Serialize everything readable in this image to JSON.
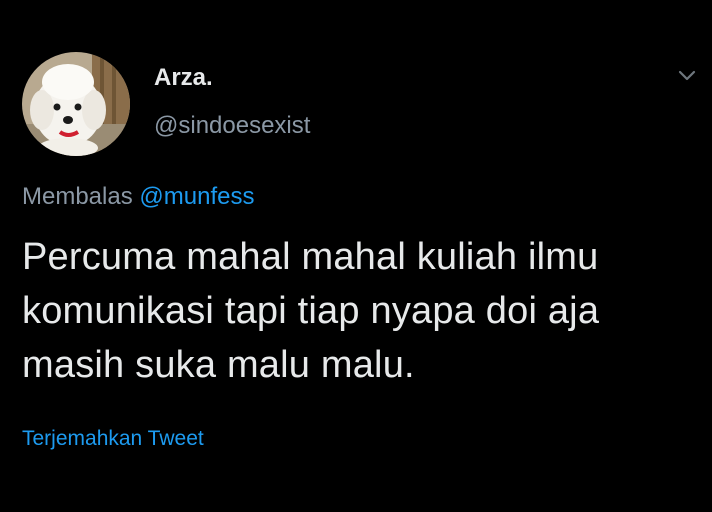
{
  "tweet": {
    "display_name": "Arza.",
    "handle": "@sindoesexist",
    "reply_prefix": "Membalas",
    "reply_mention": "@munfess",
    "text": "Percuma mahal mahal kuliah ilmu\nkomunikasi tapi tiap nyapa doi aja\nmasih suka malu malu.",
    "translate_label": "Terjemahkan Tweet"
  },
  "icons": {
    "avatar": "dog-avatar",
    "menu": "chevron-down-icon"
  },
  "colors": {
    "background": "#000000",
    "primary_text": "#e7e9ea",
    "secondary_text": "#8b98a5",
    "accent": "#1d9bf0"
  }
}
